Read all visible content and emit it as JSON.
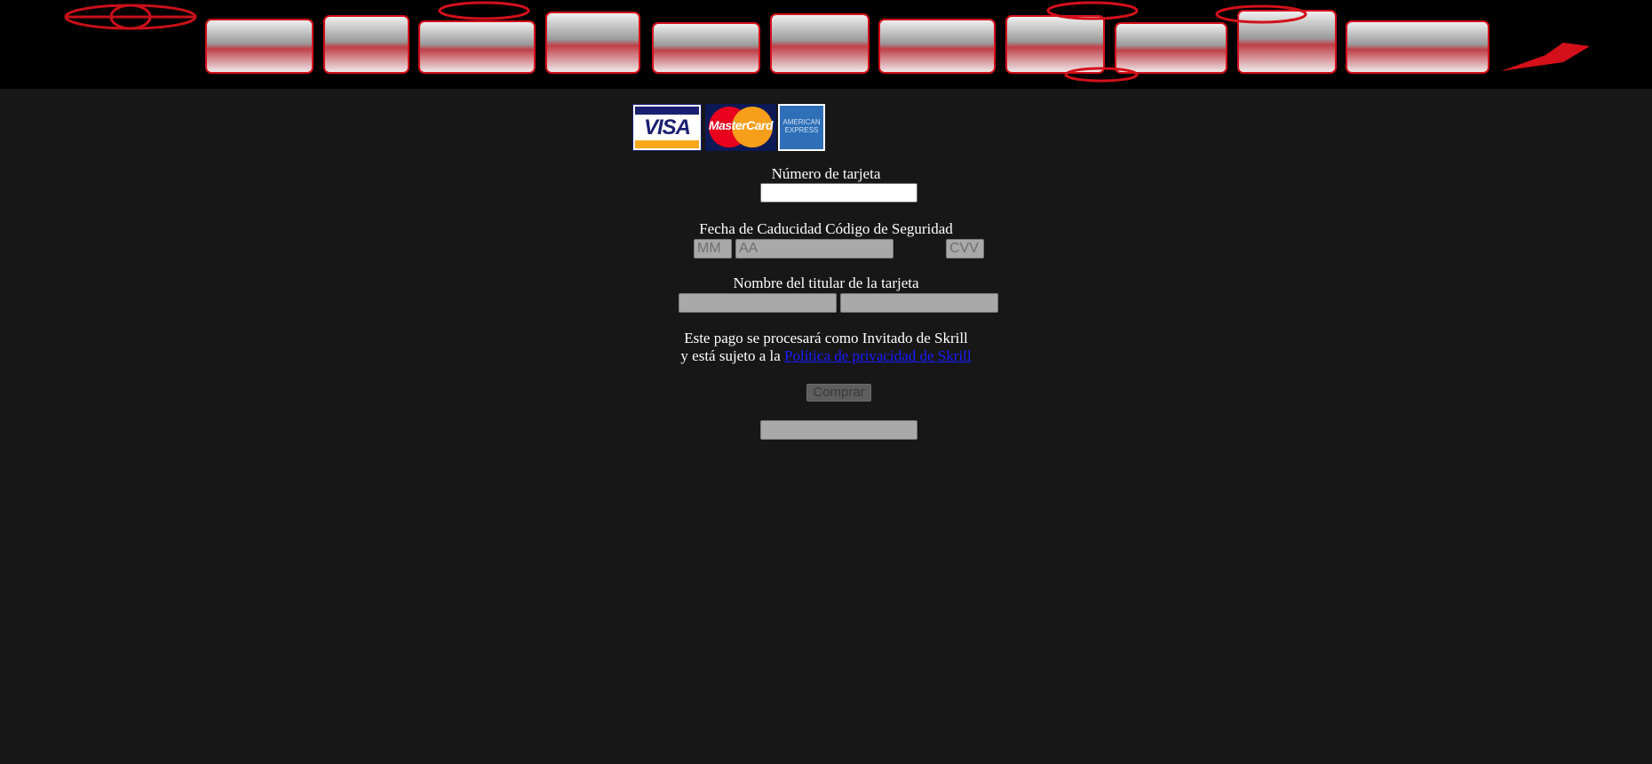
{
  "logos": {
    "visa": "VISA",
    "mastercard": "MasterCard",
    "amex_line1": "AMERICAN",
    "amex_line2": "EXPRESS"
  },
  "form": {
    "card_number_label": "Número de tarjeta",
    "card_number_value": "",
    "expiry_cvv_label": "Fecha de Caducidad Código de Seguridad",
    "month_placeholder": "MM",
    "year_placeholder": "AA",
    "cvv_placeholder": "CVV",
    "holder_label": "Nombre del titular de la tarjeta",
    "holder_first_value": "",
    "holder_last_value": ""
  },
  "notice": {
    "line1": "Este pago se procesará como Invitado de Skrill",
    "line2_prefix": "y está sujeto a la ",
    "privacy_link": "Política de privacidad de Skrill"
  },
  "actions": {
    "buy_label": "Comprar",
    "extra_field_value": ""
  },
  "colors": {
    "background": "#171717",
    "banner_bg": "#000000",
    "banner_red": "#d4101a",
    "link": "#1a1aff"
  }
}
